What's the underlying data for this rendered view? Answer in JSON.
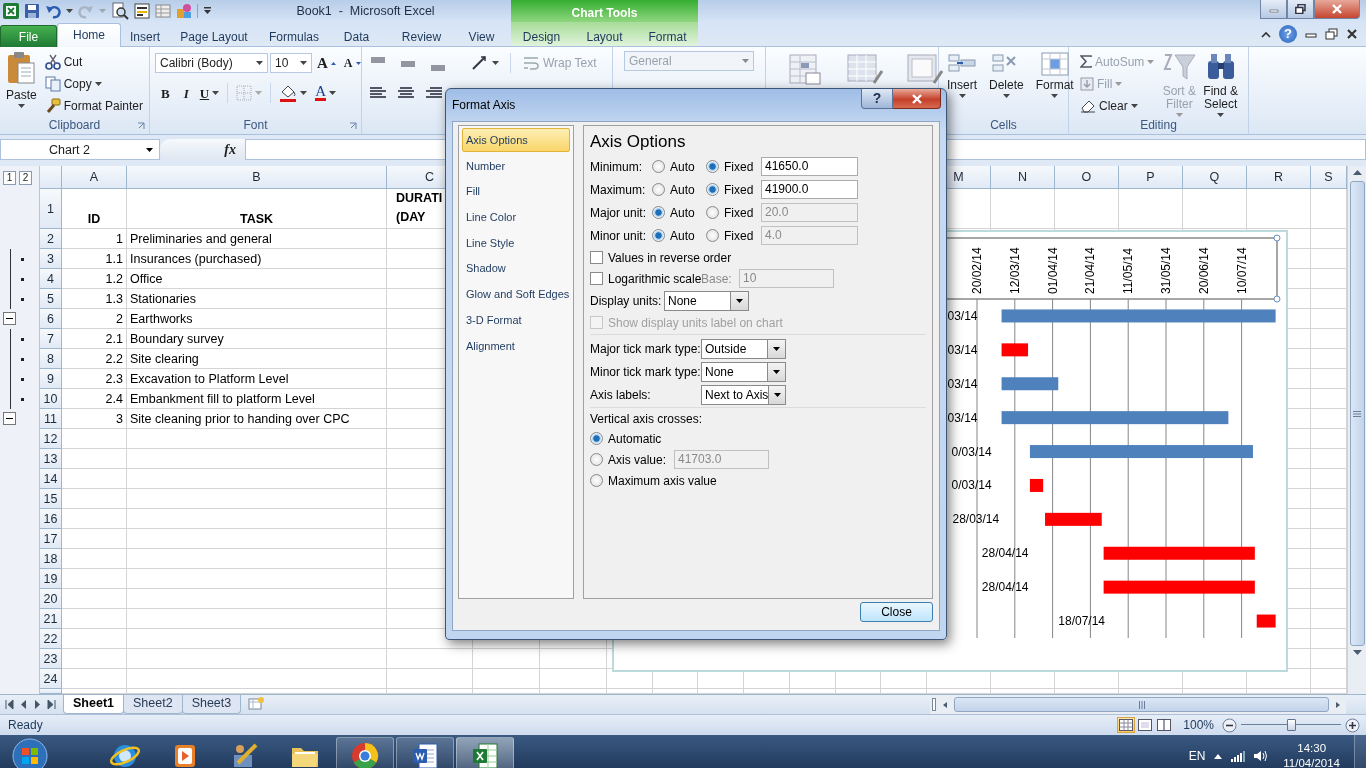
{
  "window": {
    "title": "Book1  -  Microsoft Excel",
    "tool_group": "Chart Tools",
    "help": "?"
  },
  "ribbon_tabs": [
    {
      "label": "File",
      "kind": "file",
      "selected": false
    },
    {
      "label": "Home",
      "kind": "normal",
      "selected": true
    },
    {
      "label": "Insert",
      "kind": "normal",
      "selected": false
    },
    {
      "label": "Page Layout",
      "kind": "normal",
      "selected": false
    },
    {
      "label": "Formulas",
      "kind": "normal",
      "selected": false
    },
    {
      "label": "Data",
      "kind": "normal",
      "selected": false
    },
    {
      "label": "Review",
      "kind": "normal",
      "selected": false
    },
    {
      "label": "View",
      "kind": "normal",
      "selected": false
    },
    {
      "label": "Design",
      "kind": "context",
      "selected": false
    },
    {
      "label": "Layout",
      "kind": "context",
      "selected": false
    },
    {
      "label": "Format",
      "kind": "context",
      "selected": false
    }
  ],
  "clipboard": {
    "label": "Clipboard",
    "paste": "Paste",
    "cut": "Cut",
    "copy": "Copy",
    "format_painter": "Format Painter"
  },
  "font": {
    "label": "Font",
    "name": "Calibri (Body)",
    "size": "10",
    "grow": "A",
    "shrink": "A",
    "bold": "B",
    "italic": "I",
    "underline": "U",
    "font_color_button": "A"
  },
  "alignment": {
    "wrap_text": {
      "label": "Wrap Text",
      "disabled": true
    }
  },
  "number": {
    "format": {
      "value": "General",
      "disabled": true
    }
  },
  "cells": {
    "label": "Cells",
    "buttons": [
      "Insert",
      "Delete",
      "Format"
    ]
  },
  "editing": {
    "label": "Editing",
    "autosum": {
      "label": "AutoSum",
      "disabled": true
    },
    "fill": {
      "label": "Fill",
      "disabled": true
    },
    "clear": {
      "label": "Clear",
      "disabled": false
    },
    "sort_filter": {
      "label": "Sort &\nFilter",
      "disabled": true
    },
    "find_select": {
      "label": "Find &\nSelect",
      "disabled": false
    }
  },
  "formula_bar": {
    "name_box": "Chart 2",
    "fx": "fx"
  },
  "sheet": {
    "outline_levels": [
      "1",
      "2"
    ],
    "columns_left": [
      "A",
      "B",
      "C"
    ],
    "columns_right": [
      "M",
      "N",
      "O",
      "P",
      "Q",
      "R",
      "S"
    ],
    "rows": [
      {
        "number": "1",
        "kind": "header",
        "id": "ID",
        "task": "TASK",
        "duration": "DURATI\n(DAY"
      },
      {
        "number": "2",
        "kind": "task",
        "id": "1",
        "task": "Preliminaries and general"
      },
      {
        "number": "3",
        "kind": "task",
        "id": "1.1",
        "task": "Insurances (purchased)",
        "outline": {
          "kind": "dot"
        }
      },
      {
        "number": "4",
        "kind": "task",
        "id": "1.2",
        "task": "Office",
        "outline": {
          "kind": "dot"
        }
      },
      {
        "number": "5",
        "kind": "task",
        "id": "1.3",
        "task": "Stationaries",
        "outline": {
          "kind": "dot"
        }
      },
      {
        "number": "6",
        "kind": "task",
        "id": "2",
        "task": "Earthworks",
        "outline": {
          "kind": "collapse"
        }
      },
      {
        "number": "7",
        "kind": "task",
        "id": "2.1",
        "task": "Boundary survey",
        "outline": {
          "kind": "dot"
        }
      },
      {
        "number": "8",
        "kind": "task",
        "id": "2.2",
        "task": "Site clearing",
        "outline": {
          "kind": "dot"
        }
      },
      {
        "number": "9",
        "kind": "task",
        "id": "2.3",
        "task": "Excavation to Platform Level",
        "outline": {
          "kind": "dot"
        }
      },
      {
        "number": "10",
        "kind": "task",
        "id": "2.4",
        "task": "Embankment fill to platform Level",
        "outline": {
          "kind": "dot"
        }
      },
      {
        "number": "11",
        "kind": "task",
        "id": "3",
        "task": "Site cleaning prior to handing over CPC",
        "outline": {
          "kind": "collapse"
        }
      },
      {
        "number": "12",
        "kind": "blank"
      },
      {
        "number": "13",
        "kind": "blank"
      },
      {
        "number": "14",
        "kind": "blank"
      },
      {
        "number": "15",
        "kind": "blank"
      },
      {
        "number": "16",
        "kind": "blank"
      },
      {
        "number": "17",
        "kind": "blank"
      },
      {
        "number": "18",
        "kind": "blank"
      },
      {
        "number": "19",
        "kind": "blank"
      },
      {
        "number": "20",
        "kind": "blank"
      },
      {
        "number": "21",
        "kind": "blank"
      },
      {
        "number": "22",
        "kind": "blank"
      },
      {
        "number": "23",
        "kind": "blank"
      },
      {
        "number": "24",
        "kind": "blank"
      }
    ]
  },
  "chart": {
    "axis_labels": [
      "20/02/14",
      "12/03/14",
      "01/04/14",
      "21/04/14",
      "11/05/14",
      "31/05/14",
      "20/06/14",
      "10/07/14"
    ],
    "data_labels": [
      "03/14",
      "03/14",
      "03/14",
      "03/14",
      "0/03/14",
      "0/03/14",
      "28/03/14",
      "28/04/14",
      "28/04/14",
      "18/07/14"
    ]
  },
  "dialog": {
    "title": "Format Axis",
    "help": "?",
    "nav": [
      {
        "label": "Axis Options",
        "selected": true
      },
      {
        "label": "Number",
        "selected": false
      },
      {
        "label": "Fill",
        "selected": false
      },
      {
        "label": "Line Color",
        "selected": false
      },
      {
        "label": "Line Style",
        "selected": false
      },
      {
        "label": "Shadow",
        "selected": false
      },
      {
        "label": "Glow and Soft Edges",
        "selected": false
      },
      {
        "label": "3-D Format",
        "selected": false
      },
      {
        "label": "Alignment",
        "selected": false
      }
    ],
    "heading": "Axis Options",
    "bounds": [
      {
        "label": "Minimum:",
        "options": [
          {
            "label": "Auto",
            "selected": false
          },
          {
            "label": "Fixed",
            "selected": true
          }
        ],
        "value": "41650.0",
        "disabled": false
      },
      {
        "label": "Maximum:",
        "options": [
          {
            "label": "Auto",
            "selected": false
          },
          {
            "label": "Fixed",
            "selected": true
          }
        ],
        "value": "41900.0",
        "disabled": false
      },
      {
        "label": "Major unit:",
        "options": [
          {
            "label": "Auto",
            "selected": true
          },
          {
            "label": "Fixed",
            "selected": false
          }
        ],
        "value": "20.0",
        "disabled": true
      },
      {
        "label": "Minor unit:",
        "options": [
          {
            "label": "Auto",
            "selected": true
          },
          {
            "label": "Fixed",
            "selected": false
          }
        ],
        "value": "4.0",
        "disabled": true
      }
    ],
    "reverse": {
      "label": "Values in reverse order",
      "checked": false,
      "disabled": false
    },
    "log": {
      "label": "Logarithmic scale",
      "checked": false,
      "disabled": false
    },
    "log_base": {
      "label": "Base:",
      "value": "10",
      "disabled": true
    },
    "display_units": {
      "label": "Display units:",
      "value": "None"
    },
    "show_units_label": {
      "label": "Show display units label on chart",
      "checked": false,
      "disabled": true
    },
    "dropdowns": [
      {
        "label": "Major tick mark type:",
        "value": "Outside"
      },
      {
        "label": "Minor tick mark type:",
        "value": "None"
      },
      {
        "label": "Axis labels:",
        "value": "Next to Axis"
      }
    ],
    "crosses": {
      "label": "Vertical axis crosses:",
      "options": [
        {
          "label": "Automatic",
          "selected": true
        },
        {
          "label": "Axis value:",
          "selected": false,
          "value": "41703.0",
          "disabled": true
        },
        {
          "label": "Maximum axis value",
          "selected": false
        }
      ]
    },
    "close": "Close"
  },
  "sheet_tabs": [
    {
      "label": "Sheet1",
      "selected": true
    },
    {
      "label": "Sheet2",
      "selected": false
    },
    {
      "label": "Sheet3",
      "selected": false
    }
  ],
  "status_bar": {
    "status": "Ready",
    "views": [
      {
        "kind": "normal",
        "selected": true
      },
      {
        "kind": "page_layout",
        "selected": false
      },
      {
        "kind": "page_break",
        "selected": false
      }
    ],
    "zoom": {
      "label": "100%",
      "level": 0.5
    }
  },
  "taskbar": {
    "apps": [
      {
        "kind": "globe",
        "open": false,
        "selected": false
      },
      {
        "kind": "player",
        "open": false,
        "selected": false
      },
      {
        "kind": "figure",
        "open": false,
        "selected": false
      },
      {
        "kind": "folder",
        "open": false,
        "selected": false
      },
      {
        "kind": "ring",
        "open": true,
        "selected": false
      },
      {
        "kind": "doc",
        "open": true,
        "selected": false
      },
      {
        "kind": "sheet",
        "open": true,
        "selected": true
      }
    ],
    "language": "EN",
    "time": "14:30",
    "date": "11/04/2014"
  }
}
